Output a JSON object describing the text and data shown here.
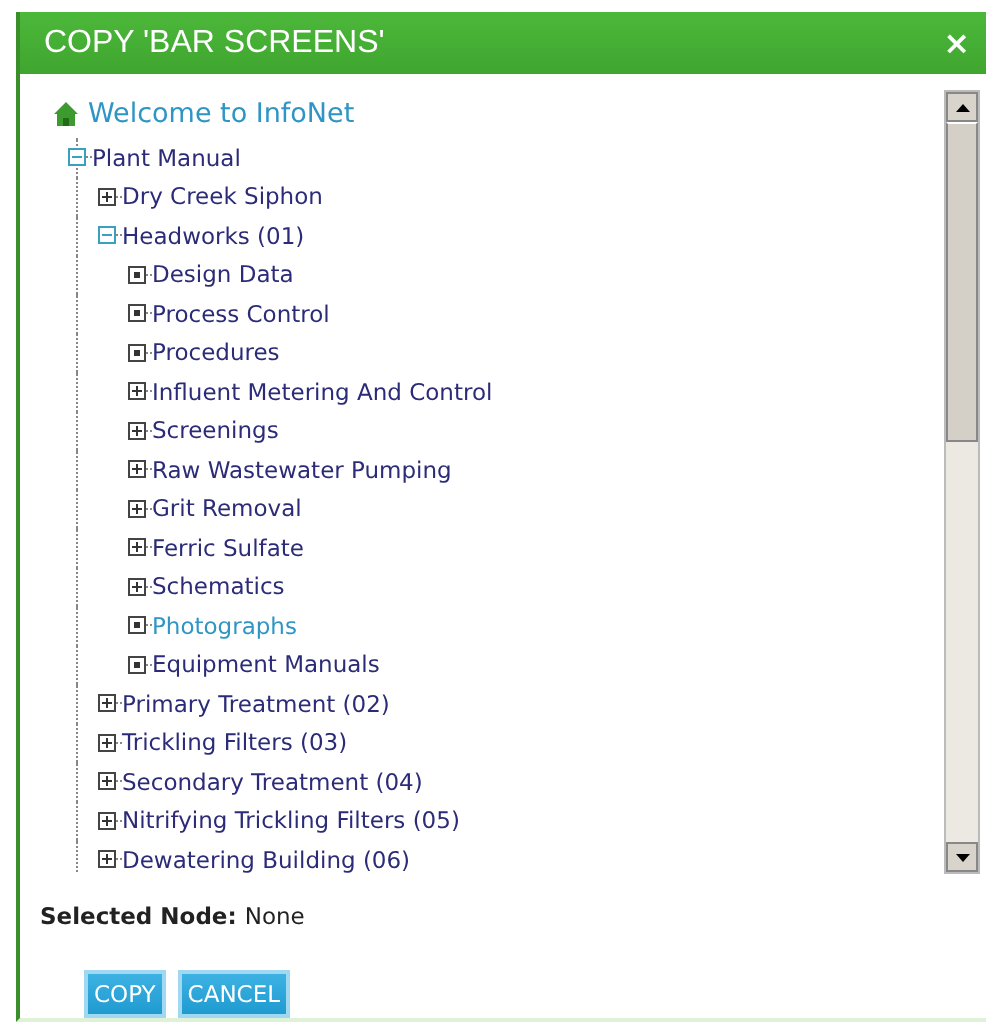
{
  "window": {
    "title": "COPY 'BAR SCREENS'",
    "close": "×"
  },
  "tree": {
    "root": "Welcome to InfoNet",
    "items": [
      {
        "label": "Plant Manual",
        "kind": "branch",
        "expanded": true,
        "highlighted": false,
        "children": [
          {
            "label": "Dry Creek Siphon",
            "kind": "branch",
            "expanded": false,
            "highlighted": false
          },
          {
            "label": "Headworks (01)",
            "kind": "branch",
            "expanded": true,
            "highlighted": false,
            "children": [
              {
                "label": "Design Data",
                "kind": "leaf",
                "expanded": false,
                "highlighted": false
              },
              {
                "label": "Process Control",
                "kind": "leaf",
                "expanded": false,
                "highlighted": false
              },
              {
                "label": "Procedures",
                "kind": "leaf",
                "expanded": false,
                "highlighted": false
              },
              {
                "label": "Influent Metering And Control",
                "kind": "branch",
                "expanded": false,
                "highlighted": false
              },
              {
                "label": "Screenings",
                "kind": "branch",
                "expanded": false,
                "highlighted": false
              },
              {
                "label": "Raw Wastewater Pumping",
                "kind": "branch",
                "expanded": false,
                "highlighted": false
              },
              {
                "label": "Grit Removal",
                "kind": "branch",
                "expanded": false,
                "highlighted": false
              },
              {
                "label": "Ferric Sulfate",
                "kind": "branch",
                "expanded": false,
                "highlighted": false
              },
              {
                "label": "Schematics",
                "kind": "branch",
                "expanded": false,
                "highlighted": false
              },
              {
                "label": "Photographs",
                "kind": "leaf",
                "expanded": false,
                "highlighted": true
              },
              {
                "label": "Equipment Manuals",
                "kind": "leaf",
                "expanded": false,
                "highlighted": false
              }
            ]
          },
          {
            "label": "Primary Treatment (02)",
            "kind": "branch",
            "expanded": false,
            "highlighted": false
          },
          {
            "label": "Trickling Filters (03)",
            "kind": "branch",
            "expanded": false,
            "highlighted": false
          },
          {
            "label": "Secondary Treatment (04)",
            "kind": "branch",
            "expanded": false,
            "highlighted": false
          },
          {
            "label": "Nitrifying Trickling Filters (05)",
            "kind": "branch",
            "expanded": false,
            "highlighted": false
          },
          {
            "label": "Dewatering Building (06)",
            "kind": "branch",
            "expanded": false,
            "highlighted": false
          }
        ]
      }
    ]
  },
  "selected_node": {
    "label": "Selected Node:",
    "value": "None"
  },
  "buttons": [
    "COPY",
    "CANCEL"
  ]
}
